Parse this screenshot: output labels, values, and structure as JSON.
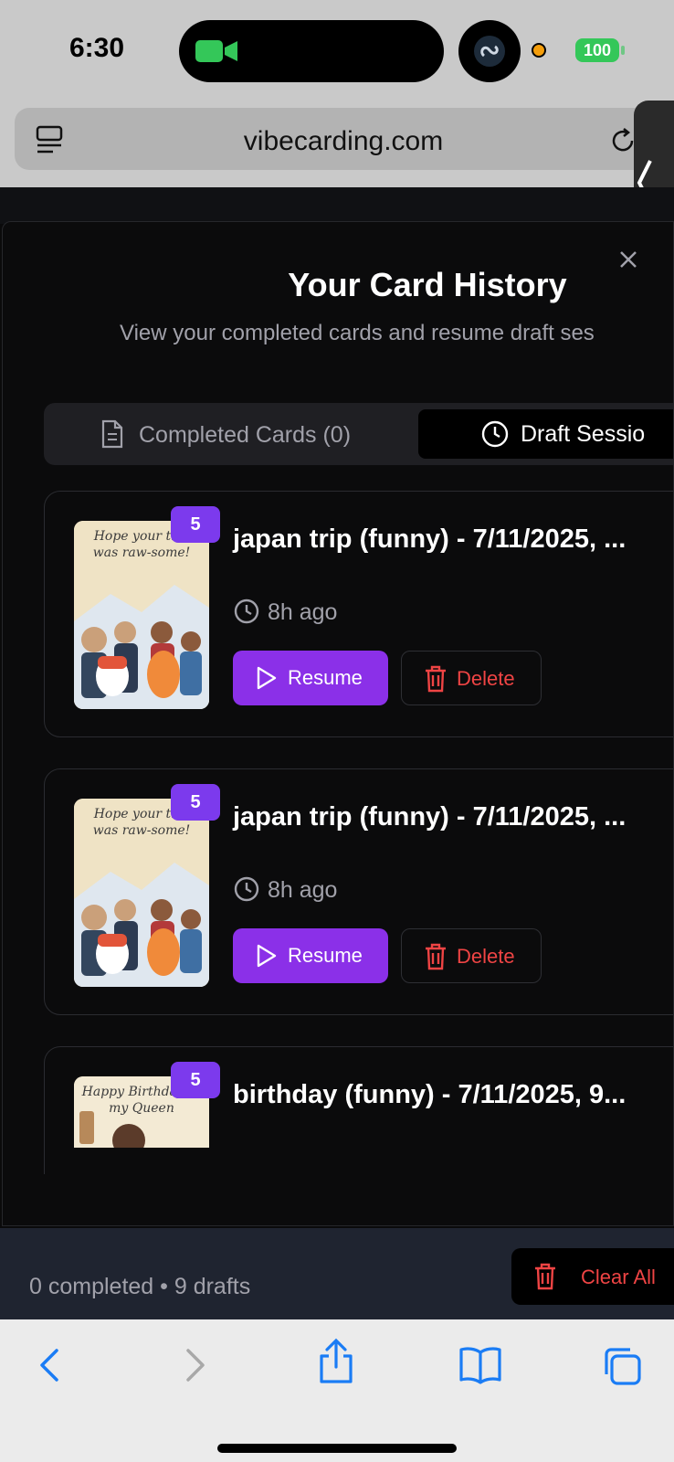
{
  "status_bar": {
    "time": "6:30",
    "battery": "100"
  },
  "browser": {
    "url": "vibecarding.com"
  },
  "modal": {
    "title": "Your Card History",
    "subtitle": "View your completed cards and resume draft ses",
    "tabs": [
      {
        "label": "Completed Cards (0)",
        "active": false
      },
      {
        "label": "Draft Sessio",
        "active": true
      }
    ],
    "drafts": [
      {
        "badge": "5",
        "title": "japan trip (funny) - 7/11/2025, ...",
        "time": "8h ago",
        "thumb_text": "Hope your trip was raw-some!",
        "resume": "Resume",
        "delete": "Delete"
      },
      {
        "badge": "5",
        "title": "japan trip (funny) - 7/11/2025, ...",
        "time": "8h ago",
        "thumb_text": "Hope your trip was raw-some!",
        "resume": "Resume",
        "delete": "Delete"
      },
      {
        "badge": "5",
        "title": "birthday (funny) - 7/11/2025, 9...",
        "thumb_text": "Happy Birthday to my Queen"
      }
    ],
    "footer": {
      "summary": "0 completed • 9 drafts",
      "clear_all": "Clear All"
    }
  },
  "colors": {
    "accent": "#8b30e8",
    "danger": "#ef4444",
    "background": "#0b0b0c"
  }
}
